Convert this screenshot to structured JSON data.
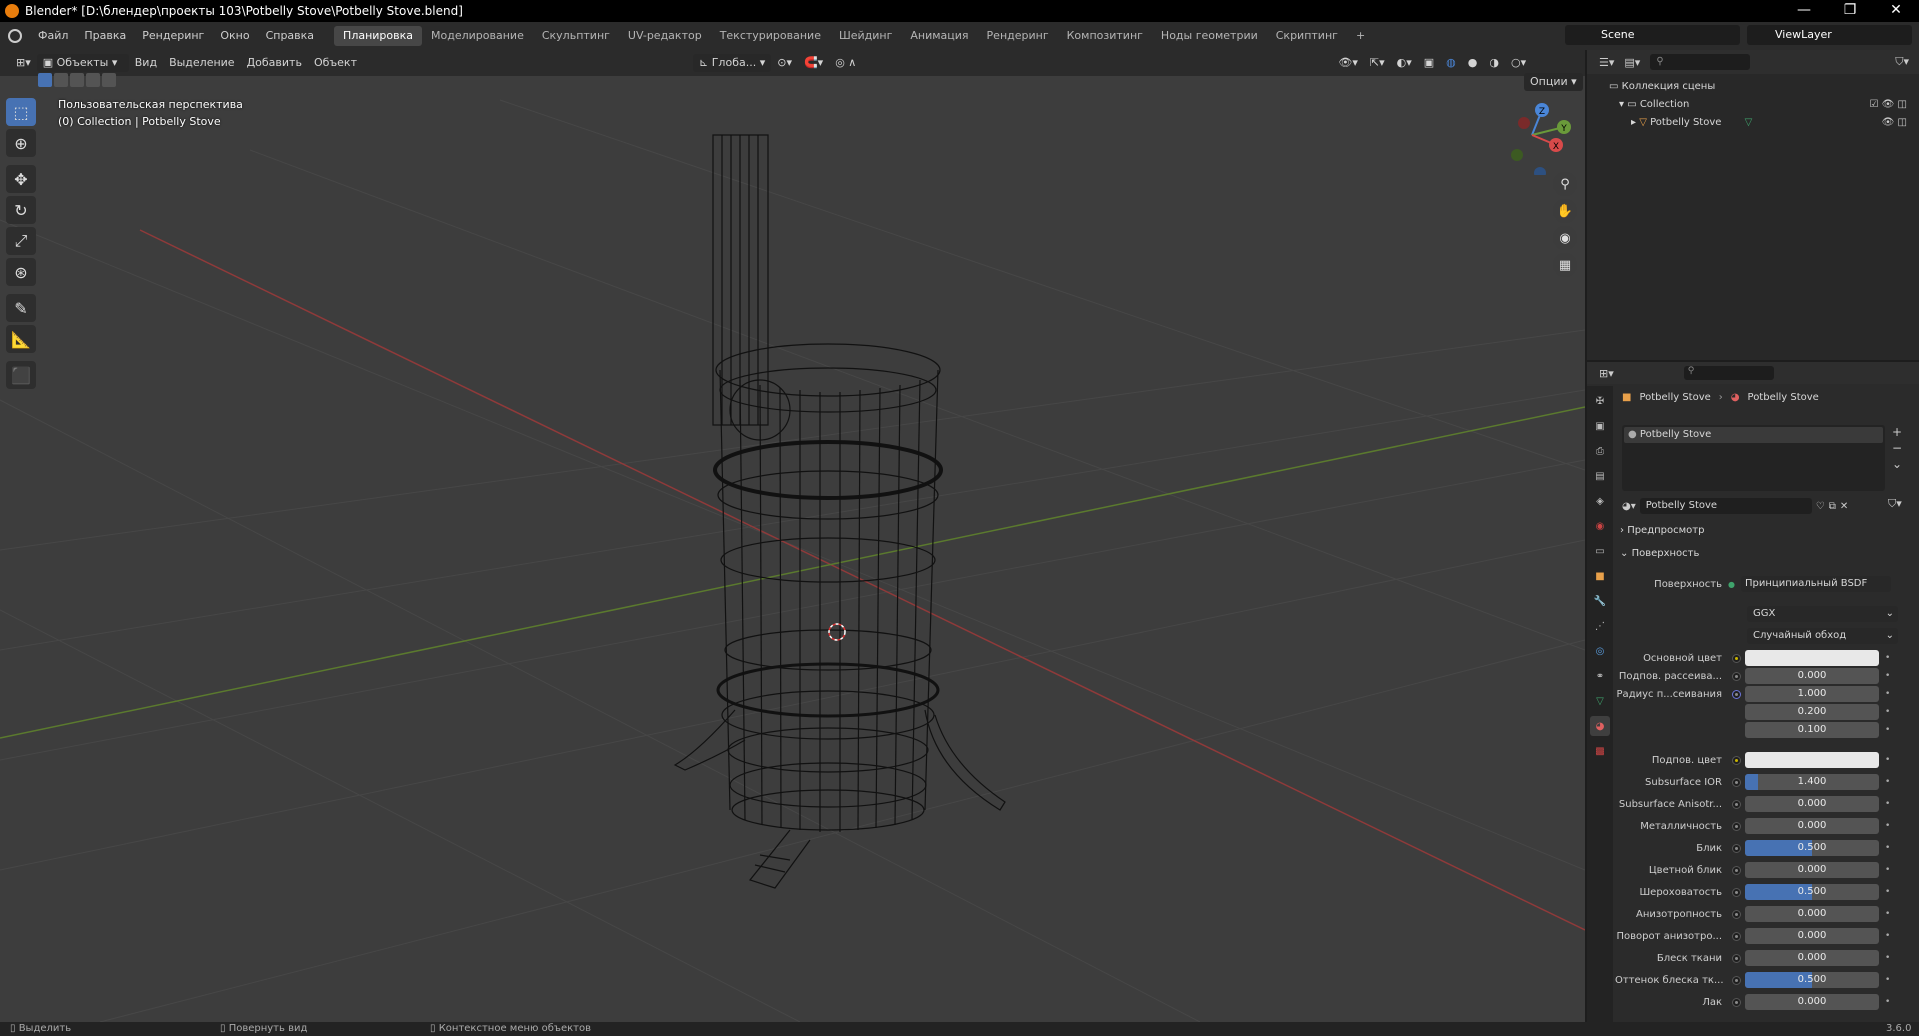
{
  "titlebar": {
    "title": "Blender* [D:\\блендер\\проекты 103\\Potbelly Stove\\Potbelly Stove.blend]",
    "min": "—",
    "max": "❐",
    "close": "✕"
  },
  "menu": [
    "Файл",
    "Правка",
    "Рендеринг",
    "Окно",
    "Справка"
  ],
  "workspaces": [
    "Планировка",
    "Моделирование",
    "Скульптинг",
    "UV-редактор",
    "Текстурирование",
    "Шейдинг",
    "Анимация",
    "Рендеринг",
    "Композитинг",
    "Ноды геометрии",
    "Скриптинг",
    "+"
  ],
  "active_workspace": 0,
  "scene": {
    "label": "Scene"
  },
  "viewlayer": {
    "label": "ViewLayer"
  },
  "viewport_header": {
    "mode": "Объекты",
    "view": "Вид",
    "select": "Выделение",
    "add": "Добавить",
    "object": "Объект",
    "transform": "Глоба...",
    "options": "Опции"
  },
  "viewport_overlay": {
    "line1": "Пользовательская перспектива",
    "line2": "(0) Collection | Potbelly Stove"
  },
  "gizmo": {
    "x": "X",
    "y": "Y",
    "z": "Z"
  },
  "outliner": {
    "root": "Коллекция сцены",
    "collection": "Collection",
    "object": "Potbelly Stove"
  },
  "properties": {
    "breadcrumb_object": "Potbelly Stove",
    "breadcrumb_material": "Potbelly Stove",
    "slot": "Potbelly Stove",
    "material_name": "Potbelly Stove",
    "preview": "Предпросмотр",
    "surface_panel": "Поверхность",
    "surface_label": "Поверхность",
    "surface_value": "Принципиальный BSDF",
    "distribution": "GGX",
    "subsurface_method": "Случайный обход",
    "fields": [
      {
        "label": "Основной цвет",
        "type": "color",
        "value": "",
        "fill": 0,
        "dot": "yellow"
      },
      {
        "label": "Подпов. рассеива...",
        "type": "num",
        "value": "0.000",
        "fill": 0,
        "dot": "gray"
      },
      {
        "label": "Радиус п...сеивания",
        "type": "num",
        "value": "1.000",
        "fill": 0,
        "dot": "blue"
      },
      {
        "label": "",
        "type": "num",
        "value": "0.200",
        "fill": 0,
        "dot": "none"
      },
      {
        "label": "",
        "type": "num",
        "value": "0.100",
        "fill": 0,
        "dot": "none"
      },
      {
        "label": "Подпов. цвет",
        "type": "color",
        "value": "",
        "fill": 0,
        "dot": "yellow"
      },
      {
        "label": "Subsurface IOR",
        "type": "num",
        "value": "1.400",
        "fill": 0.1,
        "dot": "gray"
      },
      {
        "label": "Subsurface Anisotr...",
        "type": "num",
        "value": "0.000",
        "fill": 0,
        "dot": "gray"
      },
      {
        "label": "Металличность",
        "type": "num",
        "value": "0.000",
        "fill": 0,
        "dot": "gray"
      },
      {
        "label": "Блик",
        "type": "num",
        "value": "0.500",
        "fill": 0.5,
        "dot": "gray"
      },
      {
        "label": "Цветной блик",
        "type": "num",
        "value": "0.000",
        "fill": 0,
        "dot": "gray"
      },
      {
        "label": "Шероховатость",
        "type": "num",
        "value": "0.500",
        "fill": 0.5,
        "dot": "gray"
      },
      {
        "label": "Анизотропность",
        "type": "num",
        "value": "0.000",
        "fill": 0,
        "dot": "gray"
      },
      {
        "label": "Поворот анизотро...",
        "type": "num",
        "value": "0.000",
        "fill": 0,
        "dot": "gray"
      },
      {
        "label": "Блеск ткани",
        "type": "num",
        "value": "0.000",
        "fill": 0,
        "dot": "gray"
      },
      {
        "label": "Оттенок блеска тк...",
        "type": "num",
        "value": "0.500",
        "fill": 0.5,
        "dot": "gray"
      },
      {
        "label": "Лак",
        "type": "num",
        "value": "0.000",
        "fill": 0,
        "dot": "gray"
      }
    ]
  },
  "statusbar": {
    "select": "Выделить",
    "rotate": "Повернуть вид",
    "context": "Контекстное меню объектов",
    "version": "3.6.0"
  },
  "colors": {
    "accent": "#4772b3",
    "x_axis": "#d84a4a",
    "y_axis": "#6a9a3a",
    "z_axis": "#4a86d8"
  }
}
